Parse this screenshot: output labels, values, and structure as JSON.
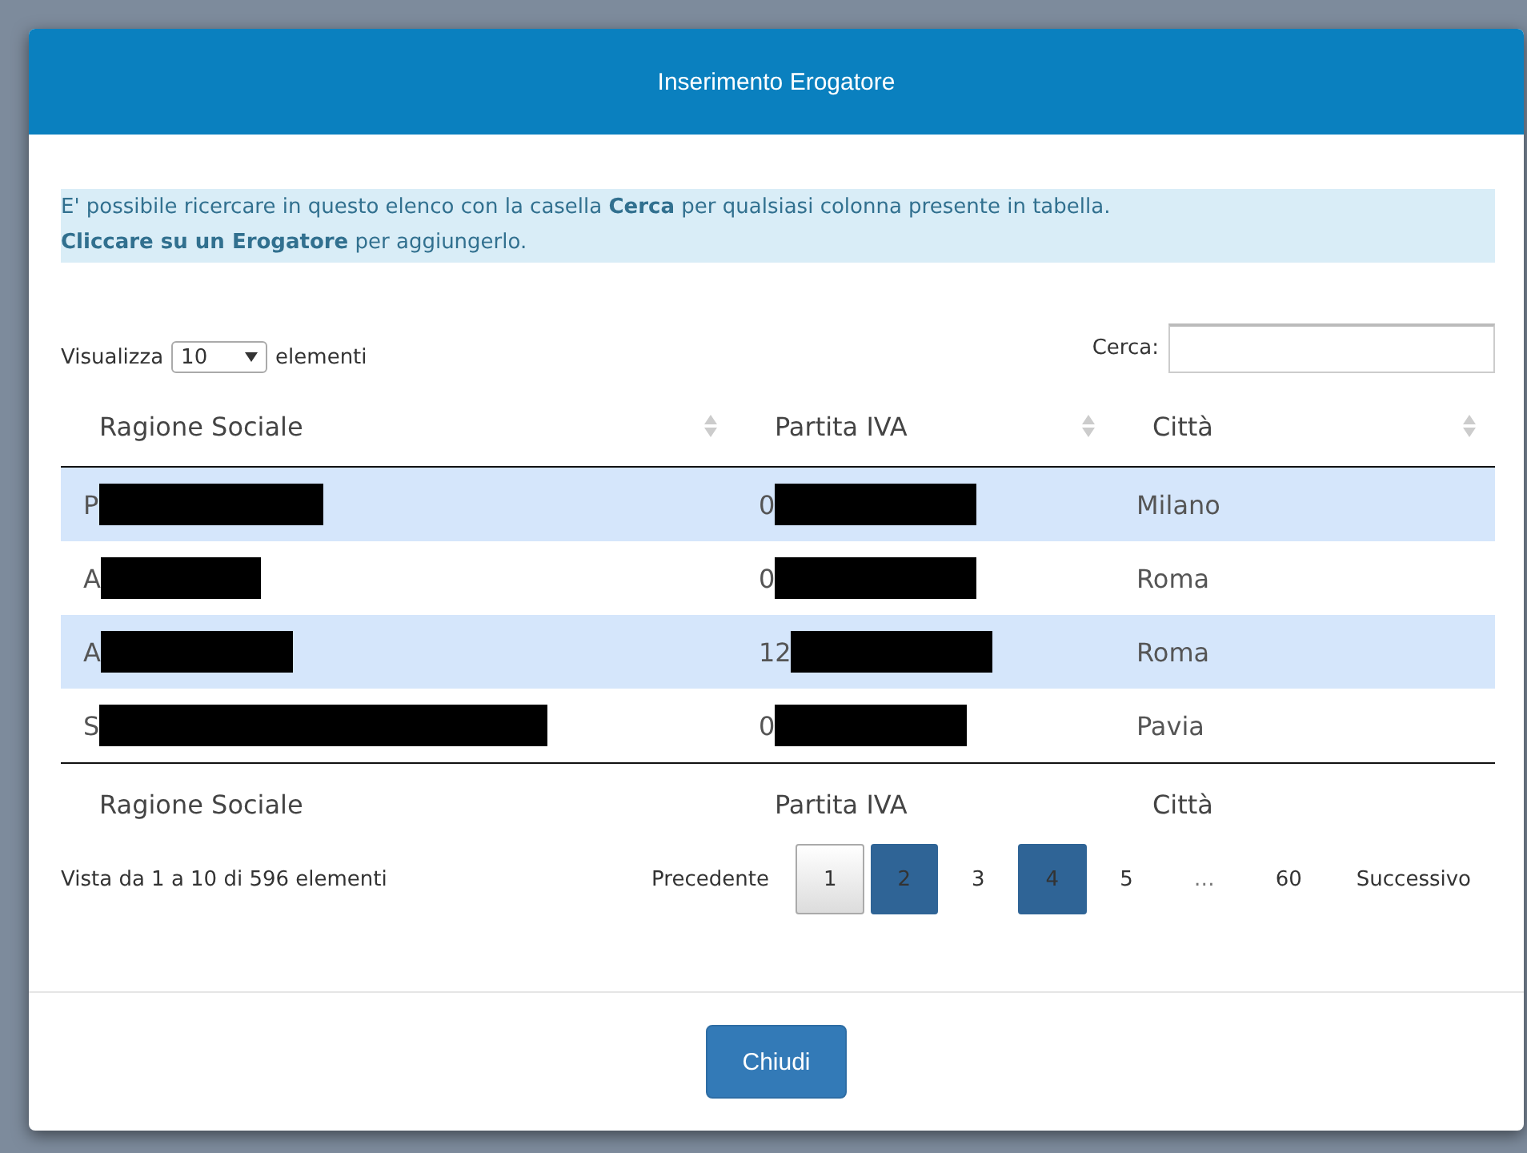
{
  "dialog": {
    "title": "Inserimento Erogatore"
  },
  "info": [
    "E' possibile ricercare in questo elenco con la casella **Cerca** per qualsiasi colonna presente in tabella.",
    "**Cliccare su un Erogatore** per aggiungerlo."
  ],
  "length_control": {
    "label_before": "Visualizza",
    "value": "10",
    "label_after": "elementi"
  },
  "search": {
    "label": "Cerca:"
  },
  "table": {
    "columns": [
      "Ragione Sociale",
      "Partita IVA",
      "Città"
    ],
    "rows": [
      {
        "cells": [
          {
            "text": "P",
            "redacted": true
          },
          {
            "text": "0",
            "redacted": true
          },
          {
            "text": "Milano",
            "redacted": false
          }
        ]
      },
      {
        "cells": [
          {
            "text": "A",
            "redacted": true
          },
          {
            "text": "0",
            "redacted": true
          },
          {
            "text": "Roma",
            "redacted": false
          }
        ]
      },
      {
        "cells": [
          {
            "text": "A",
            "redacted": true
          },
          {
            "text": "12",
            "redacted": true
          },
          {
            "text": "Roma",
            "redacted": false
          }
        ]
      },
      {
        "cells": [
          {
            "text": "S",
            "redacted": true
          },
          {
            "text": "0",
            "redacted": true
          },
          {
            "text": "Pavia",
            "redacted": false
          }
        ]
      }
    ],
    "footer_columns": [
      "Ragione Sociale",
      "Partita IVA",
      "Città"
    ]
  },
  "info_text": "Vista da 1 a 10 di 596 elementi",
  "pagination": [
    {
      "label": "Precedente",
      "kind": "plain"
    },
    {
      "label": "1",
      "kind": "current"
    },
    {
      "label": "2",
      "kind": "highlighted"
    },
    {
      "label": "3",
      "kind": "plain"
    },
    {
      "label": "4",
      "kind": "highlighted"
    },
    {
      "label": "5",
      "kind": "plain"
    },
    {
      "label": "…",
      "kind": "ellipsis"
    },
    {
      "label": "60",
      "kind": "plain"
    },
    {
      "label": "Successivo",
      "kind": "plain"
    }
  ],
  "buttons": [
    "Chiudi"
  ]
}
